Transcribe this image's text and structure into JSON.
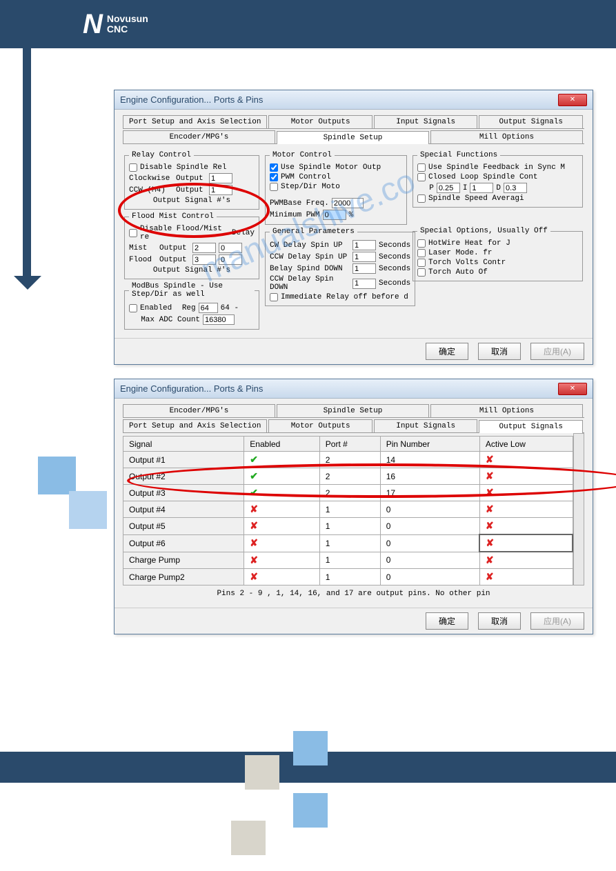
{
  "brand": {
    "name": "Novusun",
    "sub": "CNC"
  },
  "dialog1": {
    "title": "Engine Configuration... Ports & Pins",
    "tabs_top": [
      "Port Setup and Axis Selection",
      "Motor Outputs",
      "Input Signals",
      "Output Signals"
    ],
    "tabs_bottom": [
      "Encoder/MPG's",
      "Spindle Setup",
      "Mill Options"
    ],
    "relay": {
      "legend": "Relay Control",
      "disable": "Disable Spindle Rel",
      "cw": "Clockwise",
      "out": "Output",
      "cw_val": "1",
      "ccw": "CCW (M4)",
      "ccw_val": "1",
      "sig": "Output Signal #'s"
    },
    "flood": {
      "legend": "Flood Mist Control",
      "disable": "Disable Flood/Mist re",
      "delay": "Delay",
      "mist": "Mist",
      "mist_out": "2",
      "mist_delay": "0",
      "flood": "Flood",
      "flood_out": "3",
      "flood_delay": "0",
      "sig": "Output Signal #'s"
    },
    "modbus": {
      "legend": "ModBus Spindle - Use Step/Dir as well",
      "enabled": "Enabled",
      "reg": "Reg",
      "reg_a": "64",
      "reg_b": "64 -",
      "max": "Max ADC Count",
      "max_val": "16380"
    },
    "motor": {
      "legend": "Motor Control",
      "use": "Use Spindle Motor Outp",
      "pwm": "PWM Control",
      "step": "Step/Dir Moto",
      "freq": "PWMBase Freq.",
      "freq_val": "2000",
      "min": "Minimum PWM",
      "min_val": "0",
      "pct": "%"
    },
    "general": {
      "legend": "General Parameters",
      "r1": "CW Delay Spin UP",
      "v1": "1",
      "sec": "Seconds",
      "r2": "CCW Delay Spin UP",
      "v2": "1",
      "r3": "Belay Spind DOWN",
      "v3": "1",
      "r4": "CCW Delay Spin DOWN",
      "v4": "1",
      "immed": "Immediate Relay off before d"
    },
    "special_func": {
      "legend": "Special Functions",
      "l1": "Use Spindle Feedback in Sync M",
      "l2": "Closed Loop Spindle Cont",
      "p": "P",
      "pv": "0.25",
      "i": "I",
      "iv": "1",
      "d": "D",
      "dv": "0.3",
      "l3": "Spindle Speed Averagi"
    },
    "special_opt": {
      "legend": "Special Options, Usually Off",
      "o1": "HotWire Heat for J",
      "o2": "Laser Mode. fr",
      "o3": "Torch Volts Contr",
      "o4": "Torch Auto Of"
    },
    "ok": "确定",
    "cancel": "取消",
    "apply": "应用(A)"
  },
  "dialog2": {
    "title": "Engine Configuration... Ports & Pins",
    "tabs_top": [
      "Encoder/MPG's",
      "Spindle Setup",
      "Mill Options"
    ],
    "tabs_bottom": [
      "Port Setup and Axis Selection",
      "Motor Outputs",
      "Input Signals",
      "Output Signals"
    ],
    "headers": [
      "Signal",
      "Enabled",
      "Port #",
      "Pin Number",
      "Active Low"
    ],
    "rows": [
      {
        "sig": "Output #1",
        "en": true,
        "port": "2",
        "pin": "14",
        "low": false
      },
      {
        "sig": "Output #2",
        "en": true,
        "port": "2",
        "pin": "16",
        "low": false
      },
      {
        "sig": "Output #3",
        "en": true,
        "port": "2",
        "pin": "17",
        "low": false
      },
      {
        "sig": "Output #4",
        "en": false,
        "port": "1",
        "pin": "0",
        "low": false
      },
      {
        "sig": "Output #5",
        "en": false,
        "port": "1",
        "pin": "0",
        "low": false
      },
      {
        "sig": "Output #6",
        "en": false,
        "port": "1",
        "pin": "0",
        "low": false,
        "sel": true
      },
      {
        "sig": "Charge Pump",
        "en": false,
        "port": "1",
        "pin": "0",
        "low": false
      },
      {
        "sig": "Charge Pump2",
        "en": false,
        "port": "1",
        "pin": "0",
        "low": false
      }
    ],
    "footer": "Pins 2 - 9 , 1, 14, 16, and 17 are output pins. No  other pin",
    "ok": "确定",
    "cancel": "取消",
    "apply": "应用(A)"
  },
  "watermark": "manualshive.co"
}
